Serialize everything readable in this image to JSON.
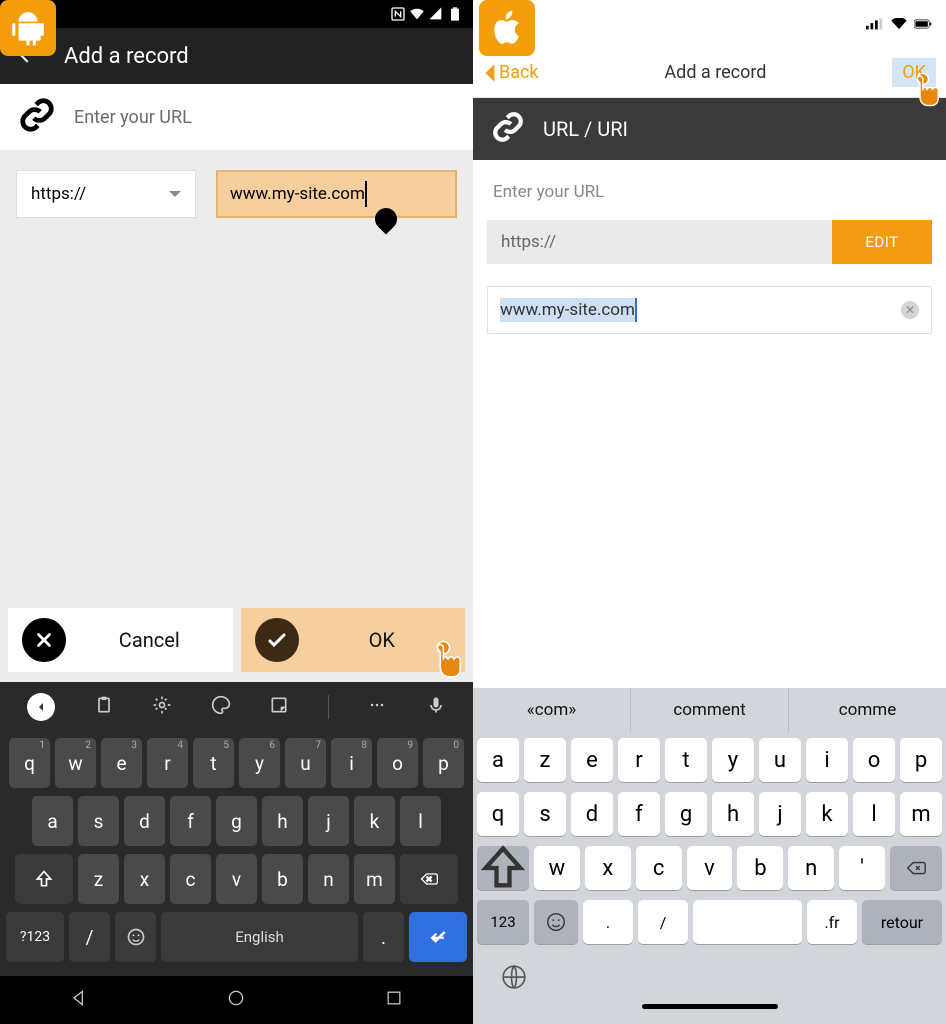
{
  "android": {
    "header": {
      "title": "Add a record"
    },
    "url_label": "Enter your URL",
    "scheme": "https://",
    "input_value": "www.my-site.com",
    "cancel_label": "Cancel",
    "ok_label": "OK",
    "keyboard": {
      "row1": [
        "q",
        "w",
        "e",
        "r",
        "t",
        "y",
        "u",
        "i",
        "o",
        "p"
      ],
      "row1_sup": [
        "1",
        "2",
        "3",
        "4",
        "5",
        "6",
        "7",
        "8",
        "9",
        "0"
      ],
      "row2": [
        "a",
        "s",
        "d",
        "f",
        "g",
        "h",
        "j",
        "k",
        "l"
      ],
      "row3": [
        "z",
        "x",
        "c",
        "v",
        "b",
        "n",
        "m"
      ],
      "sym": "?123",
      "slash": "/",
      "space": "English",
      "dot": "."
    }
  },
  "ios": {
    "back_label": "Back",
    "header_title": "Add a record",
    "ok_label": "OK",
    "urlbar_label": "URL / URI",
    "enter_label": "Enter your URL",
    "scheme": "https://",
    "edit_label": "EDIT",
    "input_value": "www.my-site.com",
    "suggestions": [
      "«com»",
      "comment",
      "comme"
    ],
    "keyboard": {
      "row1": [
        "a",
        "z",
        "e",
        "r",
        "t",
        "y",
        "u",
        "i",
        "o",
        "p"
      ],
      "row2": [
        "q",
        "s",
        "d",
        "f",
        "g",
        "h",
        "j",
        "k",
        "l",
        "m"
      ],
      "row3": [
        "w",
        "x",
        "c",
        "v",
        "b",
        "n",
        "'"
      ],
      "sym": "123",
      "dot": ".",
      "slash": "/",
      "fr": ".fr",
      "ret": "retour"
    }
  }
}
